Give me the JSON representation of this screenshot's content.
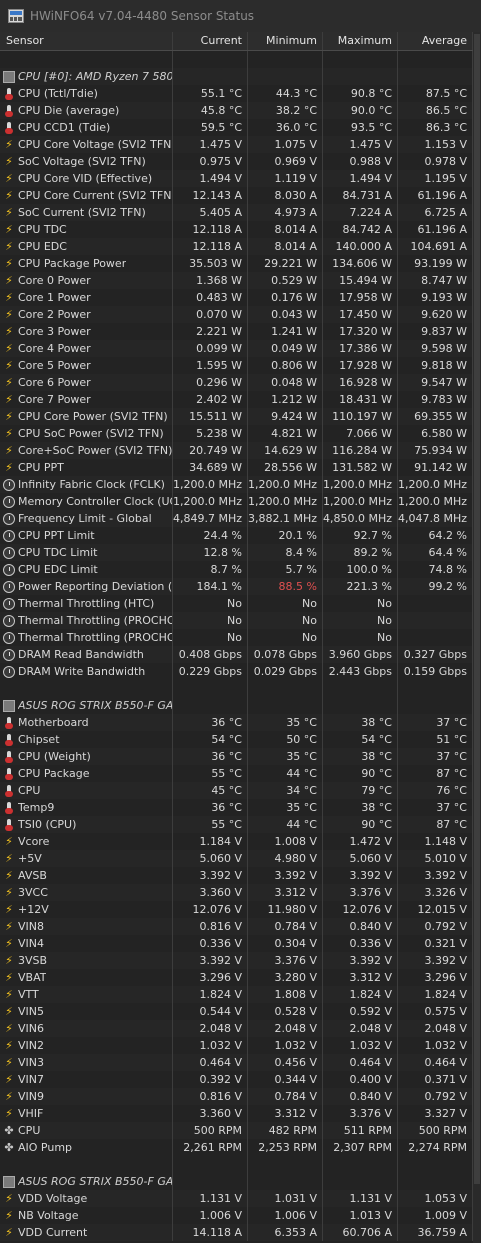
{
  "window": {
    "title": "HWiNFO64 v7.04-4480 Sensor Status"
  },
  "columns": [
    "Sensor",
    "Current",
    "Minimum",
    "Maximum",
    "Average"
  ],
  "rows": [
    {
      "kind": "gap"
    },
    {
      "kind": "group",
      "name": "CPU [#0]: AMD Ryzen 7 580..."
    },
    {
      "kind": "row",
      "icon": "thermo",
      "name": "CPU (Tctl/Tdie)",
      "cur": "55.1 °C",
      "min": "44.3 °C",
      "max": "90.8 °C",
      "avg": "87.5 °C"
    },
    {
      "kind": "row",
      "icon": "thermo",
      "name": "CPU Die (average)",
      "cur": "45.8 °C",
      "min": "38.2 °C",
      "max": "90.0 °C",
      "avg": "86.5 °C"
    },
    {
      "kind": "row",
      "icon": "thermo",
      "name": "CPU CCD1 (Tdie)",
      "cur": "59.5 °C",
      "min": "36.0 °C",
      "max": "93.5 °C",
      "avg": "86.3 °C"
    },
    {
      "kind": "row",
      "icon": "bolt",
      "name": "CPU Core Voltage (SVI2 TFN)",
      "cur": "1.475 V",
      "min": "1.075 V",
      "max": "1.475 V",
      "avg": "1.153 V"
    },
    {
      "kind": "row",
      "icon": "bolt",
      "name": "SoC Voltage (SVI2 TFN)",
      "cur": "0.975 V",
      "min": "0.969 V",
      "max": "0.988 V",
      "avg": "0.978 V"
    },
    {
      "kind": "row",
      "icon": "bolt",
      "name": "CPU Core VID (Effective)",
      "cur": "1.494 V",
      "min": "1.119 V",
      "max": "1.494 V",
      "avg": "1.195 V"
    },
    {
      "kind": "row",
      "icon": "bolt",
      "name": "CPU Core Current (SVI2 TFN)",
      "cur": "12.143 A",
      "min": "8.030 A",
      "max": "84.731 A",
      "avg": "61.196 A"
    },
    {
      "kind": "row",
      "icon": "bolt",
      "name": "SoC Current (SVI2 TFN)",
      "cur": "5.405 A",
      "min": "4.973 A",
      "max": "7.224 A",
      "avg": "6.725 A"
    },
    {
      "kind": "row",
      "icon": "bolt",
      "name": "CPU TDC",
      "cur": "12.118 A",
      "min": "8.014 A",
      "max": "84.742 A",
      "avg": "61.196 A"
    },
    {
      "kind": "row",
      "icon": "bolt",
      "name": "CPU EDC",
      "cur": "12.118 A",
      "min": "8.014 A",
      "max": "140.000 A",
      "avg": "104.691 A"
    },
    {
      "kind": "row",
      "icon": "bolt",
      "name": "CPU Package Power",
      "cur": "35.503 W",
      "min": "29.221 W",
      "max": "134.606 W",
      "avg": "93.199 W"
    },
    {
      "kind": "row",
      "icon": "bolt",
      "name": "Core 0 Power",
      "cur": "1.368 W",
      "min": "0.529 W",
      "max": "15.494 W",
      "avg": "8.747 W"
    },
    {
      "kind": "row",
      "icon": "bolt",
      "name": "Core 1 Power",
      "cur": "0.483 W",
      "min": "0.176 W",
      "max": "17.958 W",
      "avg": "9.193 W"
    },
    {
      "kind": "row",
      "icon": "bolt",
      "name": "Core 2 Power",
      "cur": "0.070 W",
      "min": "0.043 W",
      "max": "17.450 W",
      "avg": "9.620 W"
    },
    {
      "kind": "row",
      "icon": "bolt",
      "name": "Core 3 Power",
      "cur": "2.221 W",
      "min": "1.241 W",
      "max": "17.320 W",
      "avg": "9.837 W"
    },
    {
      "kind": "row",
      "icon": "bolt",
      "name": "Core 4 Power",
      "cur": "0.099 W",
      "min": "0.049 W",
      "max": "17.386 W",
      "avg": "9.598 W"
    },
    {
      "kind": "row",
      "icon": "bolt",
      "name": "Core 5 Power",
      "cur": "1.595 W",
      "min": "0.806 W",
      "max": "17.928 W",
      "avg": "9.818 W"
    },
    {
      "kind": "row",
      "icon": "bolt",
      "name": "Core 6 Power",
      "cur": "0.296 W",
      "min": "0.048 W",
      "max": "16.928 W",
      "avg": "9.547 W"
    },
    {
      "kind": "row",
      "icon": "bolt",
      "name": "Core 7 Power",
      "cur": "2.402 W",
      "min": "1.212 W",
      "max": "18.431 W",
      "avg": "9.783 W"
    },
    {
      "kind": "row",
      "icon": "bolt",
      "name": "CPU Core Power (SVI2 TFN)",
      "cur": "15.511 W",
      "min": "9.424 W",
      "max": "110.197 W",
      "avg": "69.355 W"
    },
    {
      "kind": "row",
      "icon": "bolt",
      "name": "CPU SoC Power (SVI2 TFN)",
      "cur": "5.238 W",
      "min": "4.821 W",
      "max": "7.066 W",
      "avg": "6.580 W"
    },
    {
      "kind": "row",
      "icon": "bolt",
      "name": "Core+SoC Power (SVI2 TFN)",
      "cur": "20.749 W",
      "min": "14.629 W",
      "max": "116.284 W",
      "avg": "75.934 W"
    },
    {
      "kind": "row",
      "icon": "bolt",
      "name": "CPU PPT",
      "cur": "34.689 W",
      "min": "28.556 W",
      "max": "131.582 W",
      "avg": "91.142 W"
    },
    {
      "kind": "row",
      "icon": "clock",
      "name": "Infinity Fabric Clock (FCLK)",
      "cur": "1,200.0 MHz",
      "min": "1,200.0 MHz",
      "max": "1,200.0 MHz",
      "avg": "1,200.0 MHz"
    },
    {
      "kind": "row",
      "icon": "clock",
      "name": "Memory Controller Clock (UC...",
      "cur": "1,200.0 MHz",
      "min": "1,200.0 MHz",
      "max": "1,200.0 MHz",
      "avg": "1,200.0 MHz"
    },
    {
      "kind": "row",
      "icon": "clock",
      "name": "Frequency Limit - Global",
      "cur": "4,849.7 MHz",
      "min": "3,882.1 MHz",
      "max": "4,850.0 MHz",
      "avg": "4,047.8 MHz"
    },
    {
      "kind": "row",
      "icon": "clock",
      "name": "CPU PPT Limit",
      "cur": "24.4 %",
      "min": "20.1 %",
      "max": "92.7 %",
      "avg": "64.2 %"
    },
    {
      "kind": "row",
      "icon": "clock",
      "name": "CPU TDC Limit",
      "cur": "12.8 %",
      "min": "8.4 %",
      "max": "89.2 %",
      "avg": "64.4 %"
    },
    {
      "kind": "row",
      "icon": "clock",
      "name": "CPU EDC Limit",
      "cur": "8.7 %",
      "min": "5.7 %",
      "max": "100.0 %",
      "avg": "74.8 %"
    },
    {
      "kind": "row",
      "icon": "clock",
      "name": "Power Reporting Deviation (...",
      "cur": "184.1 %",
      "min": "88.5 %",
      "max": "221.3 %",
      "avg": "99.2 %",
      "minRed": true
    },
    {
      "kind": "row",
      "icon": "clock",
      "name": "Thermal Throttling (HTC)",
      "cur": "No",
      "min": "No",
      "max": "No",
      "avg": ""
    },
    {
      "kind": "row",
      "icon": "clock",
      "name": "Thermal Throttling (PROCHO...",
      "cur": "No",
      "min": "No",
      "max": "No",
      "avg": ""
    },
    {
      "kind": "row",
      "icon": "clock",
      "name": "Thermal Throttling (PROCHO...",
      "cur": "No",
      "min": "No",
      "max": "No",
      "avg": ""
    },
    {
      "kind": "row",
      "icon": "clock",
      "name": "DRAM Read Bandwidth",
      "cur": "0.408 Gbps",
      "min": "0.078 Gbps",
      "max": "3.960 Gbps",
      "avg": "0.327 Gbps"
    },
    {
      "kind": "row",
      "icon": "clock",
      "name": "DRAM Write Bandwidth",
      "cur": "0.229 Gbps",
      "min": "0.029 Gbps",
      "max": "2.443 Gbps",
      "avg": "0.159 Gbps"
    },
    {
      "kind": "gap"
    },
    {
      "kind": "group",
      "name": "ASUS ROG STRIX B550-F GA..."
    },
    {
      "kind": "row",
      "icon": "thermo",
      "name": "Motherboard",
      "cur": "36 °C",
      "min": "35 °C",
      "max": "38 °C",
      "avg": "37 °C"
    },
    {
      "kind": "row",
      "icon": "thermo",
      "name": "Chipset",
      "cur": "54 °C",
      "min": "50 °C",
      "max": "54 °C",
      "avg": "51 °C"
    },
    {
      "kind": "row",
      "icon": "thermo",
      "name": "CPU (Weight)",
      "cur": "36 °C",
      "min": "35 °C",
      "max": "38 °C",
      "avg": "37 °C"
    },
    {
      "kind": "row",
      "icon": "thermo",
      "name": "CPU Package",
      "cur": "55 °C",
      "min": "44 °C",
      "max": "90 °C",
      "avg": "87 °C"
    },
    {
      "kind": "row",
      "icon": "thermo",
      "name": "CPU",
      "cur": "45 °C",
      "min": "34 °C",
      "max": "79 °C",
      "avg": "76 °C"
    },
    {
      "kind": "row",
      "icon": "thermo",
      "name": "Temp9",
      "cur": "36 °C",
      "min": "35 °C",
      "max": "38 °C",
      "avg": "37 °C"
    },
    {
      "kind": "row",
      "icon": "thermo",
      "name": "TSI0 (CPU)",
      "cur": "55 °C",
      "min": "44 °C",
      "max": "90 °C",
      "avg": "87 °C"
    },
    {
      "kind": "row",
      "icon": "bolt",
      "name": "Vcore",
      "cur": "1.184 V",
      "min": "1.008 V",
      "max": "1.472 V",
      "avg": "1.148 V"
    },
    {
      "kind": "row",
      "icon": "bolt",
      "name": "+5V",
      "cur": "5.060 V",
      "min": "4.980 V",
      "max": "5.060 V",
      "avg": "5.010 V"
    },
    {
      "kind": "row",
      "icon": "bolt",
      "name": "AVSB",
      "cur": "3.392 V",
      "min": "3.392 V",
      "max": "3.392 V",
      "avg": "3.392 V"
    },
    {
      "kind": "row",
      "icon": "bolt",
      "name": "3VCC",
      "cur": "3.360 V",
      "min": "3.312 V",
      "max": "3.376 V",
      "avg": "3.326 V"
    },
    {
      "kind": "row",
      "icon": "bolt",
      "name": "+12V",
      "cur": "12.076 V",
      "min": "11.980 V",
      "max": "12.076 V",
      "avg": "12.015 V"
    },
    {
      "kind": "row",
      "icon": "bolt",
      "name": "VIN8",
      "cur": "0.816 V",
      "min": "0.784 V",
      "max": "0.840 V",
      "avg": "0.792 V"
    },
    {
      "kind": "row",
      "icon": "bolt",
      "name": "VIN4",
      "cur": "0.336 V",
      "min": "0.304 V",
      "max": "0.336 V",
      "avg": "0.321 V"
    },
    {
      "kind": "row",
      "icon": "bolt",
      "name": "3VSB",
      "cur": "3.392 V",
      "min": "3.376 V",
      "max": "3.392 V",
      "avg": "3.392 V"
    },
    {
      "kind": "row",
      "icon": "bolt",
      "name": "VBAT",
      "cur": "3.296 V",
      "min": "3.280 V",
      "max": "3.312 V",
      "avg": "3.296 V"
    },
    {
      "kind": "row",
      "icon": "bolt",
      "name": "VTT",
      "cur": "1.824 V",
      "min": "1.808 V",
      "max": "1.824 V",
      "avg": "1.824 V"
    },
    {
      "kind": "row",
      "icon": "bolt",
      "name": "VIN5",
      "cur": "0.544 V",
      "min": "0.528 V",
      "max": "0.592 V",
      "avg": "0.575 V"
    },
    {
      "kind": "row",
      "icon": "bolt",
      "name": "VIN6",
      "cur": "2.048 V",
      "min": "2.048 V",
      "max": "2.048 V",
      "avg": "2.048 V"
    },
    {
      "kind": "row",
      "icon": "bolt",
      "name": "VIN2",
      "cur": "1.032 V",
      "min": "1.032 V",
      "max": "1.032 V",
      "avg": "1.032 V"
    },
    {
      "kind": "row",
      "icon": "bolt",
      "name": "VIN3",
      "cur": "0.464 V",
      "min": "0.456 V",
      "max": "0.464 V",
      "avg": "0.464 V"
    },
    {
      "kind": "row",
      "icon": "bolt",
      "name": "VIN7",
      "cur": "0.392 V",
      "min": "0.344 V",
      "max": "0.400 V",
      "avg": "0.371 V"
    },
    {
      "kind": "row",
      "icon": "bolt",
      "name": "VIN9",
      "cur": "0.816 V",
      "min": "0.784 V",
      "max": "0.840 V",
      "avg": "0.792 V"
    },
    {
      "kind": "row",
      "icon": "bolt",
      "name": "VHIF",
      "cur": "3.360 V",
      "min": "3.312 V",
      "max": "3.376 V",
      "avg": "3.327 V"
    },
    {
      "kind": "row",
      "icon": "fan",
      "name": "CPU",
      "cur": "500 RPM",
      "min": "482 RPM",
      "max": "511 RPM",
      "avg": "500 RPM"
    },
    {
      "kind": "row",
      "icon": "fan",
      "name": "AIO Pump",
      "cur": "2,261 RPM",
      "min": "2,253 RPM",
      "max": "2,307 RPM",
      "avg": "2,274 RPM"
    },
    {
      "kind": "gap"
    },
    {
      "kind": "group",
      "name": "ASUS ROG STRIX B550-F GA..."
    },
    {
      "kind": "row",
      "icon": "bolt",
      "name": "VDD Voltage",
      "cur": "1.131 V",
      "min": "1.031 V",
      "max": "1.131 V",
      "avg": "1.053 V"
    },
    {
      "kind": "row",
      "icon": "bolt",
      "name": "NB Voltage",
      "cur": "1.006 V",
      "min": "1.006 V",
      "max": "1.013 V",
      "avg": "1.009 V"
    },
    {
      "kind": "row",
      "icon": "bolt",
      "name": "VDD Current",
      "cur": "14.118 A",
      "min": "6.353 A",
      "max": "60.706 A",
      "avg": "36.759 A"
    }
  ]
}
